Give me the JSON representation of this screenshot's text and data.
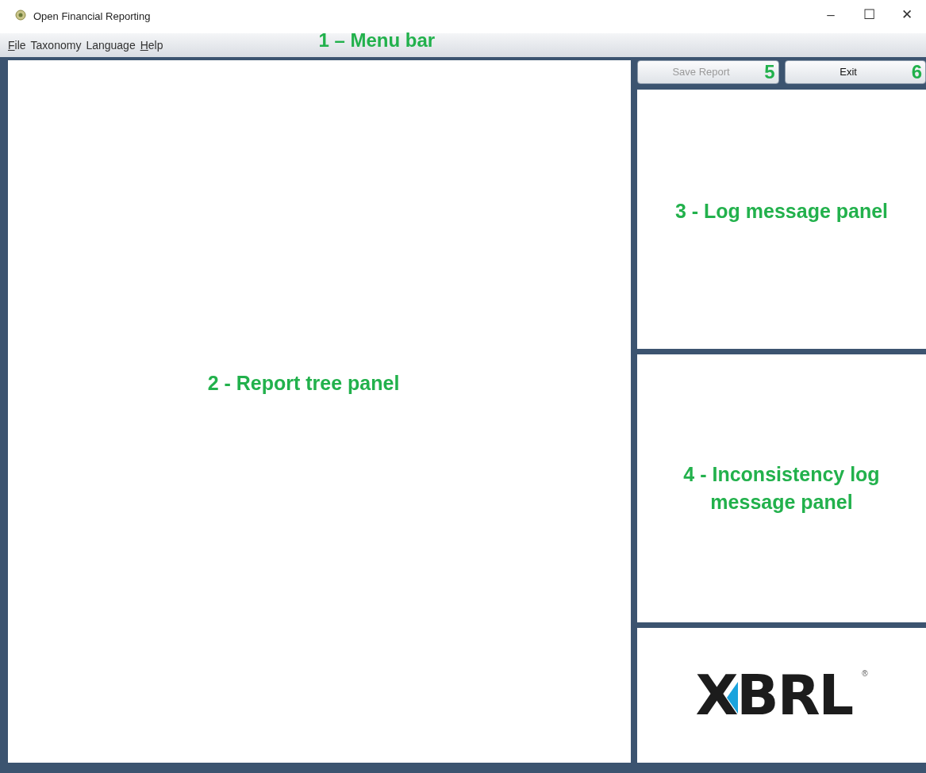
{
  "window": {
    "title": "Open Financial Reporting",
    "controls": [
      "–",
      "☐",
      "✕"
    ]
  },
  "menu_bar": {
    "items": [
      {
        "label": "File",
        "underlined_initial": true
      },
      {
        "label": "Taxonomy",
        "underlined_initial": false
      },
      {
        "label": "Language",
        "underlined_initial": false
      },
      {
        "label": "Help",
        "underlined_initial": true
      }
    ],
    "annotation": "1 – Menu bar"
  },
  "report_tree_panel": {
    "annotation": "2 - Report tree panel"
  },
  "buttons": [
    {
      "label": "Save Report",
      "disabled": true,
      "annotation": "5"
    },
    {
      "label": "Exit",
      "disabled": false,
      "annotation": "6"
    }
  ],
  "log_message_panel": {
    "annotation": "3 - Log message panel"
  },
  "inconsistency_panel": {
    "annotation": "4 - Inconsistency log message panel"
  },
  "logo": {
    "text": "XBRL",
    "mark": "®"
  }
}
